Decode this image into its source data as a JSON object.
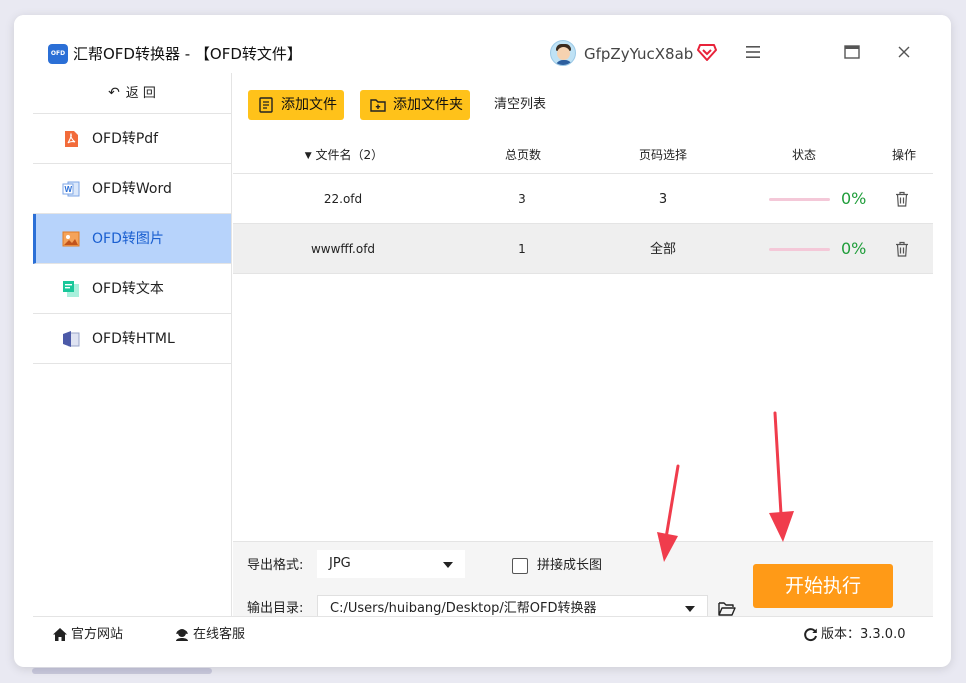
{
  "window": {
    "logo_text": "OFD",
    "title": "汇帮OFD转换器 - 【OFD转文件】",
    "username": "GfpZyYucX8ab"
  },
  "icons": {
    "menu": "hamburger-icon",
    "minimize": "maximize-icon",
    "close": "close-icon",
    "vip": "vip-diamond-icon"
  },
  "sidebar": {
    "back_label": "返  回",
    "items": [
      {
        "label": "OFD转Pdf",
        "icon": "pdf-icon"
      },
      {
        "label": "OFD转Word",
        "icon": "word-icon"
      },
      {
        "label": "OFD转图片",
        "icon": "image-icon",
        "active": true
      },
      {
        "label": "OFD转文本",
        "icon": "text-icon"
      },
      {
        "label": "OFD转HTML",
        "icon": "html-icon"
      }
    ]
  },
  "toolbar": {
    "add_file": "添加文件",
    "add_folder": "添加文件夹",
    "clear_list": "清空列表"
  },
  "table": {
    "headers": {
      "filename": "文件名（2）",
      "pages": "总页数",
      "page_select": "页码选择",
      "status": "状态",
      "action": "操作"
    },
    "rows": [
      {
        "filename": "22.ofd",
        "pages": "3",
        "page_select": "3",
        "progress": 0,
        "percent": "0%"
      },
      {
        "filename": "wwwfff.ofd",
        "pages": "1",
        "page_select": "全部",
        "progress": 0,
        "percent": "0%"
      }
    ]
  },
  "bottom": {
    "format_label": "导出格式:",
    "format_value": "JPG",
    "merge_label": "拼接成长图",
    "merge_checked": false,
    "dir_label": "输出目录:",
    "dir_value": "C:/Users/huibang/Desktop/汇帮OFD转换器",
    "start_label": "开始执行"
  },
  "statusbar": {
    "website": "官方网站",
    "support": "在线客服",
    "version": "版本：3.3.0.0"
  },
  "colors": {
    "accent_blue": "#2b6fd6",
    "active_bg": "#b7d3fb",
    "yellow_btn": "#ffc21a",
    "start_btn": "#ff9a17",
    "percent_green": "#1f9d3a",
    "annotation_red": "#f03c4c"
  }
}
